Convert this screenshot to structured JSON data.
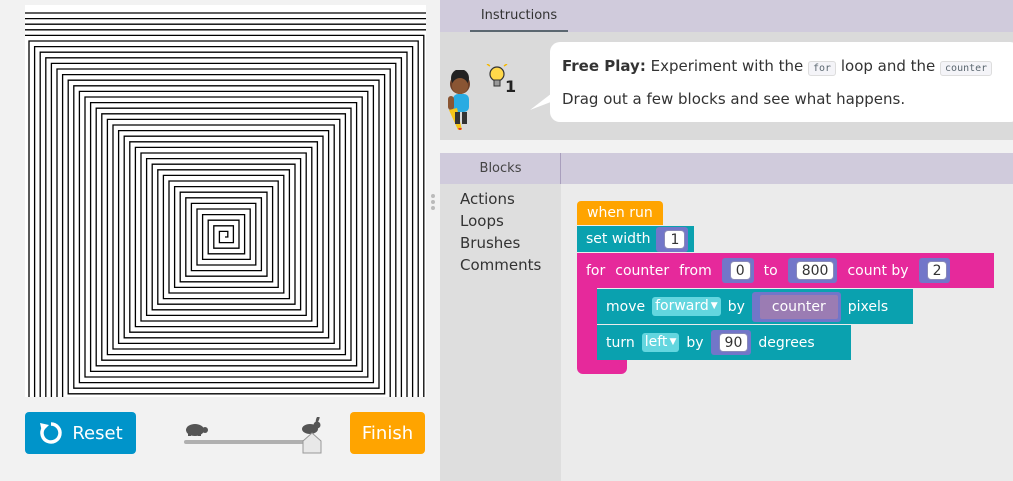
{
  "controls": {
    "reset_label": "Reset",
    "finish_label": "Finish",
    "speed_level": 1.0
  },
  "instructions": {
    "tab_label": "Instructions",
    "hint_count": "1",
    "bubble": {
      "bold": "Free Play:",
      "line1_a": " Experiment with the ",
      "code1": "for",
      "line1_b": " loop and the ",
      "code2": "counter",
      "line2": "Drag out a few blocks and see what happens."
    }
  },
  "workspace": {
    "toolbox_title": "Blocks",
    "categories": [
      "Actions",
      "Loops",
      "Brushes",
      "Comments"
    ],
    "blocks": {
      "when_run": "when run",
      "set_width_label": "set width",
      "set_width_value": "1",
      "for_label": "for",
      "for_var": "counter",
      "for_from": "from",
      "for_from_value": "0",
      "for_to": "to",
      "for_to_value": "800",
      "for_by": "count by",
      "for_by_value": "2",
      "move_label": "move",
      "move_dir": "forward",
      "move_by": "by",
      "move_var": "counter",
      "move_unit": "pixels",
      "turn_label": "turn",
      "turn_dir": "left",
      "turn_by": "by",
      "turn_value": "90",
      "turn_unit": "degrees"
    }
  },
  "colors": {
    "reset": "#0094ca",
    "finish": "#ffa400",
    "event_block": "#ffa400",
    "action_block": "#0aa1af",
    "loop_block": "#e6299b",
    "value_block": "#7276c9",
    "header": "#d0cbdc"
  },
  "icons": [
    "reset-icon",
    "turtle-icon",
    "rabbit-icon",
    "lightbulb-icon",
    "avatar-icon",
    "grip-icon",
    "dropdown-arrow-icon"
  ]
}
